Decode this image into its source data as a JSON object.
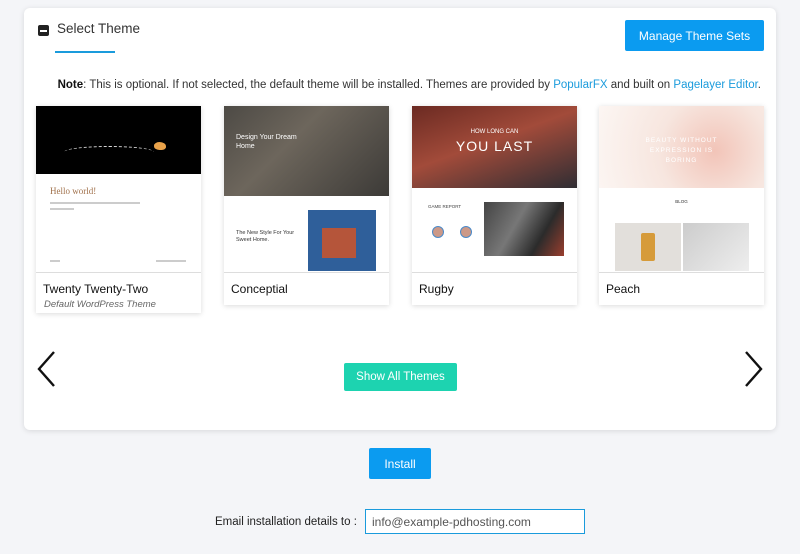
{
  "header": {
    "tab_title": "Select Theme",
    "manage_button": "Manage Theme Sets"
  },
  "note": {
    "label": "Note",
    "text_before": ": This is optional. If not selected, the default theme will be installed. Themes are provided by ",
    "link1": "PopularFX",
    "text_middle": " and built on ",
    "link2": "Pagelayer Editor",
    "text_end": "."
  },
  "themes": [
    {
      "name": "Twenty Twenty-Two",
      "subtitle": "Default WordPress Theme",
      "preview_text": "Hello world!"
    },
    {
      "name": "Conceptial",
      "preview_text": "Design Your Dream Home",
      "preview_sub": "The New Style For Your Sweet Home."
    },
    {
      "name": "Rugby",
      "preview_text": "HOW LONG CAN",
      "preview_headline": "YOU LAST",
      "preview_sub": "GAME REPORT"
    },
    {
      "name": "Peach",
      "preview_text": "BEAUTY WITHOUT EXPRESSION IS BORING",
      "preview_sub": "BLOG"
    }
  ],
  "carousel": {
    "prev_icon": "chevron-left-icon",
    "next_icon": "chevron-right-icon",
    "show_all": "Show All Themes"
  },
  "install": {
    "button": "Install",
    "email_label": "Email installation details to :",
    "email_value": "info@example-pdhosting.com"
  },
  "colors": {
    "primary": "#0b9bf0",
    "accent": "#1dd3b0",
    "link": "#1a9bdc"
  }
}
